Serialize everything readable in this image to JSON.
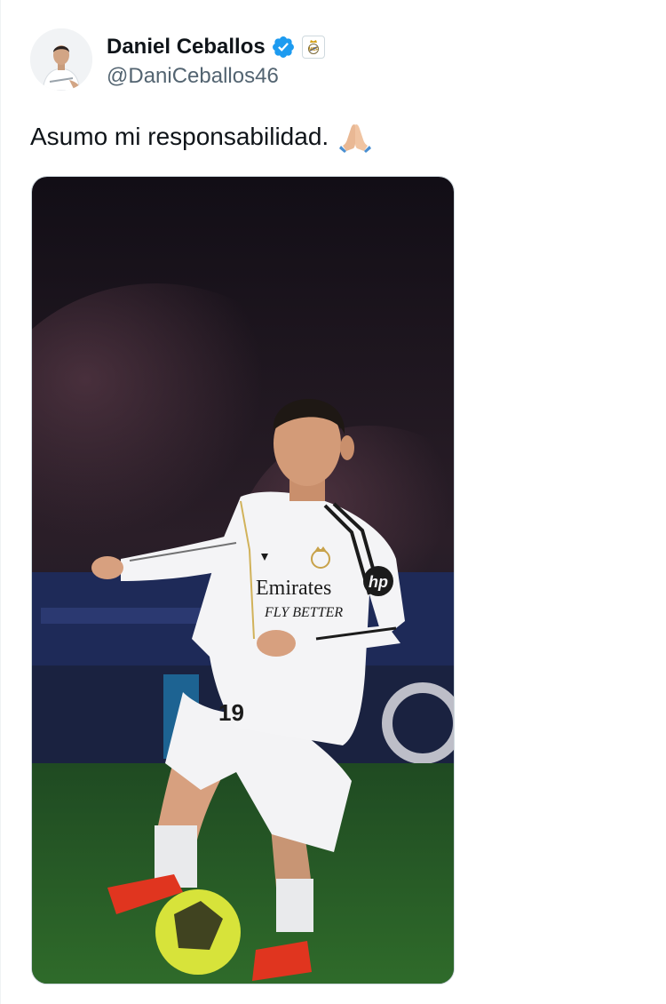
{
  "author": {
    "display_name": "Daniel Ceballos",
    "handle": "@DaniCeballos46",
    "verified": true,
    "verified_color": "#1d9bf0",
    "affiliation_badge_icon": "real-madrid-crest-icon"
  },
  "tweet": {
    "text": "Asumo mi responsabilidad.",
    "emoji": "folded-hands-emoji"
  },
  "media": {
    "kind": "photo",
    "jersey_sponsor_line1": "Emirates",
    "jersey_sponsor_line2": "FLY BETTER",
    "sleeve_logo": "hp",
    "shirt_number": "19"
  }
}
